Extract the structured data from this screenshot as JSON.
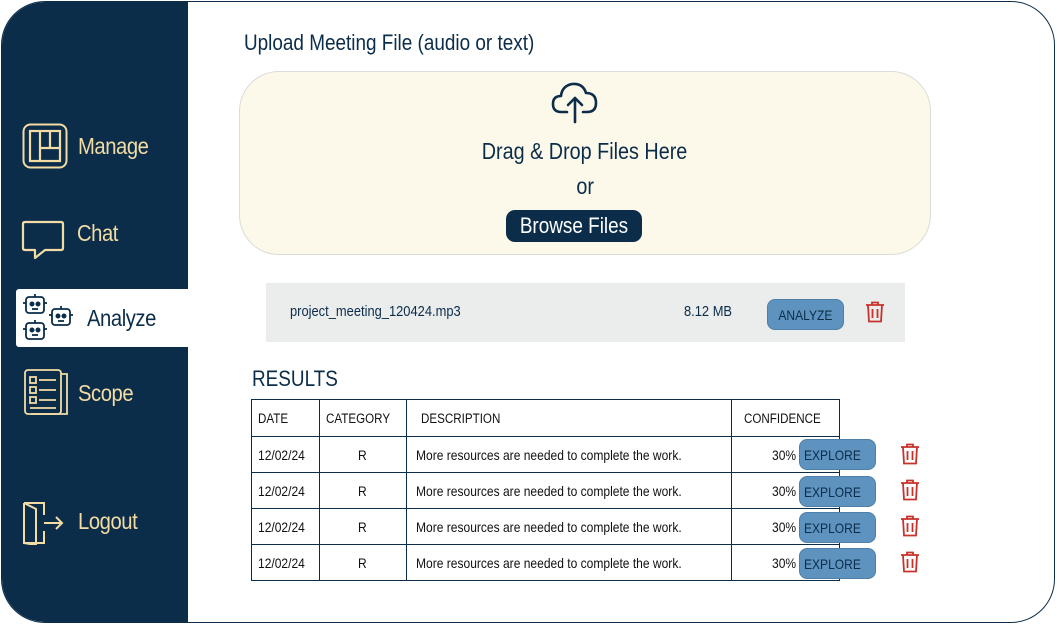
{
  "sidebar": {
    "items": [
      {
        "label": "Manage",
        "icon": "board-icon"
      },
      {
        "label": "Chat",
        "icon": "chat-bubble-icon"
      },
      {
        "label": "Analyze",
        "icon": "robots-icon",
        "active": true
      },
      {
        "label": "Scope",
        "icon": "checklist-icon"
      }
    ],
    "logout": {
      "label": "Logout",
      "icon": "logout-icon"
    }
  },
  "upload": {
    "title": "Upload Meeting File (audio or text)",
    "drop_text": "Drag & Drop Files Here",
    "or_text": "or",
    "browse_label": "Browse Files",
    "icon": "cloud-upload-icon"
  },
  "file": {
    "name": "project_meeting_120424.mp3",
    "size": "8.12 MB",
    "analyze_label": "ANALYZE"
  },
  "results": {
    "title": "RESULTS",
    "headers": [
      "DATE",
      "CATEGORY",
      "DESCRIPTION",
      "CONFIDENCE"
    ],
    "rows": [
      {
        "date": "12/02/24",
        "category": "R",
        "description": "More resources are needed to complete the work.",
        "confidence": "30%"
      },
      {
        "date": "12/02/24",
        "category": "R",
        "description": "More resources are needed to complete the work.",
        "confidence": "30%"
      },
      {
        "date": "12/02/24",
        "category": "R",
        "description": "More resources are needed to complete the work.",
        "confidence": "30%"
      },
      {
        "date": "12/02/24",
        "category": "R",
        "description": "More resources are needed to complete the work.",
        "confidence": "30%"
      }
    ],
    "explore_label": "EXPLORE"
  },
  "colors": {
    "navy": "#0b2d4a",
    "cream": "#f3dca4",
    "button_blue": "#5e93bf",
    "trash_red": "#c8322b",
    "dropzone_bg": "#fcf8ea"
  }
}
